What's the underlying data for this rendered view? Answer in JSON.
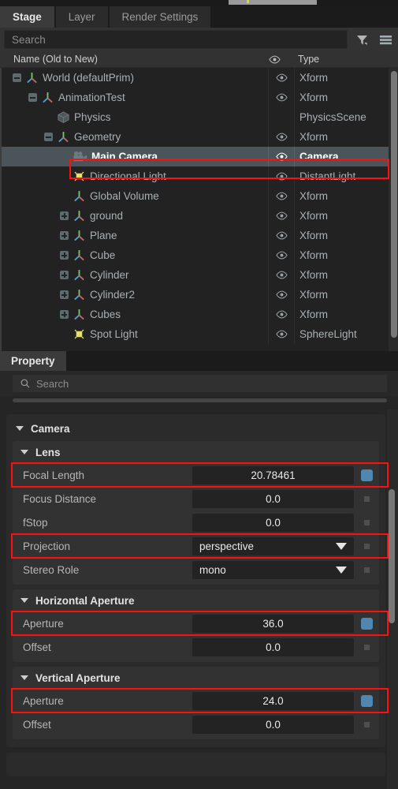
{
  "stage": {
    "tabs": [
      {
        "label": "Stage",
        "active": true
      },
      {
        "label": "Layer",
        "active": false
      },
      {
        "label": "Render Settings",
        "active": false
      }
    ],
    "search_placeholder": "Search",
    "search_value": "",
    "filter_icon": "filter-funnel-icon",
    "menu_icon": "hamburger-menu-icon",
    "columns": {
      "name": "Name (Old to New)",
      "eye": "eye-icon",
      "type": "Type"
    },
    "rows": [
      {
        "label": "World (defaultPrim)",
        "type": "Xform",
        "depth": 0,
        "icon": "xform-axis-icon",
        "expander": "minus",
        "eye": true,
        "selected": false
      },
      {
        "label": "AnimationTest",
        "type": "Xform",
        "depth": 1,
        "icon": "xform-axis-icon",
        "expander": "minus",
        "eye": true,
        "selected": false
      },
      {
        "label": "Physics",
        "type": "PhysicsScene",
        "depth": 2,
        "icon": "cube-icon",
        "expander": "none",
        "eye": false,
        "selected": false
      },
      {
        "label": "Geometry",
        "type": "Xform",
        "depth": 2,
        "icon": "xform-axis-icon",
        "expander": "minus",
        "eye": true,
        "selected": false
      },
      {
        "label": "Main Camera",
        "type": "Camera",
        "depth": 3,
        "icon": "camera-icon",
        "expander": "none",
        "eye": true,
        "selected": true
      },
      {
        "label": "Directional Light",
        "type": "DistantLight",
        "depth": 3,
        "icon": "light-icon",
        "expander": "none",
        "eye": true,
        "selected": false
      },
      {
        "label": "Global Volume",
        "type": "Xform",
        "depth": 3,
        "icon": "xform-axis-icon",
        "expander": "none",
        "eye": true,
        "selected": false
      },
      {
        "label": "ground",
        "type": "Xform",
        "depth": 3,
        "icon": "xform-axis-icon",
        "expander": "plus",
        "eye": true,
        "selected": false
      },
      {
        "label": "Plane",
        "type": "Xform",
        "depth": 3,
        "icon": "xform-axis-icon",
        "expander": "plus",
        "eye": true,
        "selected": false
      },
      {
        "label": "Cube",
        "type": "Xform",
        "depth": 3,
        "icon": "xform-axis-icon",
        "expander": "plus",
        "eye": true,
        "selected": false
      },
      {
        "label": "Cylinder",
        "type": "Xform",
        "depth": 3,
        "icon": "xform-axis-icon",
        "expander": "plus",
        "eye": true,
        "selected": false
      },
      {
        "label": "Cylinder2",
        "type": "Xform",
        "depth": 3,
        "icon": "xform-axis-icon",
        "expander": "plus",
        "eye": true,
        "selected": false
      },
      {
        "label": "Cubes",
        "type": "Xform",
        "depth": 3,
        "icon": "xform-axis-icon",
        "expander": "plus",
        "eye": true,
        "selected": false
      },
      {
        "label": "Spot Light",
        "type": "SphereLight",
        "depth": 3,
        "icon": "light-icon",
        "expander": "none",
        "eye": true,
        "selected": false
      }
    ]
  },
  "property": {
    "tab_label": "Property",
    "search_placeholder": "Search",
    "search_value": "",
    "search_icon": "search-icon",
    "group_label": "Camera",
    "sections": [
      {
        "label": "Lens",
        "rows": [
          {
            "label": "Focal Length",
            "value": "20.78461",
            "kind": "number",
            "mark": "blue",
            "highlight": true
          },
          {
            "label": "Focus Distance",
            "value": "0.0",
            "kind": "number",
            "mark": "grey",
            "highlight": false
          },
          {
            "label": "fStop",
            "value": "0.0",
            "kind": "number",
            "mark": "grey",
            "highlight": false
          },
          {
            "label": "Projection",
            "value": "perspective",
            "kind": "dropdown",
            "mark": "grey",
            "highlight": true
          },
          {
            "label": "Stereo Role",
            "value": "mono",
            "kind": "dropdown",
            "mark": "grey",
            "highlight": false
          }
        ]
      },
      {
        "label": "Horizontal Aperture",
        "rows": [
          {
            "label": "Aperture",
            "value": "36.0",
            "kind": "number",
            "mark": "blue",
            "highlight": true
          },
          {
            "label": "Offset",
            "value": "0.0",
            "kind": "number",
            "mark": "grey",
            "highlight": false
          }
        ]
      },
      {
        "label": "Vertical Aperture",
        "rows": [
          {
            "label": "Aperture",
            "value": "24.0",
            "kind": "number",
            "mark": "blue",
            "highlight": true
          },
          {
            "label": "Offset",
            "value": "0.0",
            "kind": "number",
            "mark": "grey",
            "highlight": false
          }
        ]
      }
    ]
  },
  "colors": {
    "highlight": "#ff1010",
    "selection": "#4a5459",
    "authored_mark": "#5087b0",
    "axis_green": "#7fbf6a",
    "axis_blue": "#4f9fd0",
    "axis_red": "#c06868",
    "light_yellow": "#e8e06a"
  }
}
